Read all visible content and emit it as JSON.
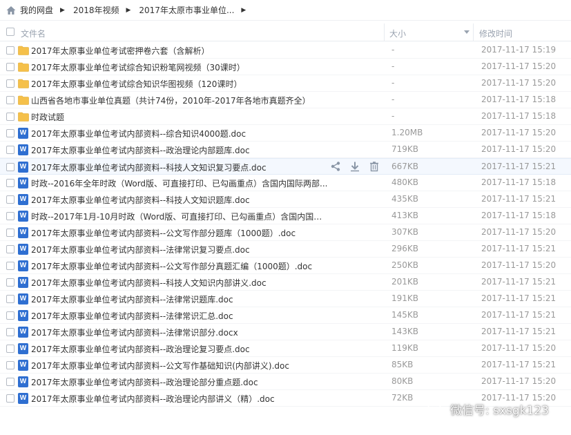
{
  "breadcrumb": {
    "items": [
      {
        "label": "我的网盘",
        "icon": "home-icon"
      },
      {
        "label": "2018年视频"
      },
      {
        "label": "2017年太原市事业单位..."
      }
    ]
  },
  "header": {
    "name_label": "文件名",
    "size_label": "大小",
    "time_label": "修改时间"
  },
  "rows": [
    {
      "type": "folder",
      "name": "2017年太原事业单位考试密押卷六套（含解析）",
      "size": "-",
      "time": "2017-11-17 15:19"
    },
    {
      "type": "folder",
      "name": "2017年太原事业单位考试综合知识粉笔网视频（30课时）",
      "size": "-",
      "time": "2017-11-17 15:20"
    },
    {
      "type": "folder",
      "name": "2017年太原事业单位考试综合知识华图视频（120课时）",
      "size": "-",
      "time": "2017-11-17 15:20"
    },
    {
      "type": "folder",
      "name": "山西省各地市事业单位真题（共计74份，2010年-2017年各地市真题齐全）",
      "size": "-",
      "time": "2017-11-17 15:18"
    },
    {
      "type": "folder",
      "name": "时政试题",
      "size": "-",
      "time": "2017-11-17 15:18"
    },
    {
      "type": "doc",
      "name": "2017年太原事业单位考试内部资料--综合知识4000题.doc",
      "size": "1.20MB",
      "time": "2017-11-17 15:20"
    },
    {
      "type": "doc",
      "name": "2017年太原事业单位考试内部资料--政治理论内部题库.doc",
      "size": "719KB",
      "time": "2017-11-17 15:20"
    },
    {
      "type": "doc",
      "name": "2017年太原事业单位考试内部资料--科技人文知识复习要点.doc",
      "size": "667KB",
      "time": "2017-11-17 15:21",
      "hover": true
    },
    {
      "type": "doc",
      "name": "时政--2016年全年时政（Word版、可直接打印、已勾画重点）含国内国际两部...",
      "size": "480KB",
      "time": "2017-11-17 15:18"
    },
    {
      "type": "doc",
      "name": "2017年太原事业单位考试内部资料--科技人文知识题库.doc",
      "size": "435KB",
      "time": "2017-11-17 15:21"
    },
    {
      "type": "doc",
      "name": "时政--2017年1月-10月时政（Word版、可直接打印、已勾画重点）含国内国际...",
      "size": "413KB",
      "time": "2017-11-17 15:18"
    },
    {
      "type": "doc",
      "name": "2017年太原事业单位考试内部资料--公文写作部分题库（1000题）.doc",
      "size": "307KB",
      "time": "2017-11-17 15:20"
    },
    {
      "type": "doc",
      "name": "2017年太原事业单位考试内部资料--法律常识复习要点.doc",
      "size": "296KB",
      "time": "2017-11-17 15:21"
    },
    {
      "type": "doc",
      "name": "2017年太原事业单位考试内部资料--公文写作部分真题汇编（1000题）.doc",
      "size": "250KB",
      "time": "2017-11-17 15:20"
    },
    {
      "type": "doc",
      "name": "2017年太原事业单位考试内部资料--科技人文知识内部讲义.doc",
      "size": "201KB",
      "time": "2017-11-17 15:21"
    },
    {
      "type": "doc",
      "name": "2017年太原事业单位考试内部资料--法律常识题库.doc",
      "size": "191KB",
      "time": "2017-11-17 15:21"
    },
    {
      "type": "doc",
      "name": "2017年太原事业单位考试内部资料--法律常识汇总.doc",
      "size": "145KB",
      "time": "2017-11-17 15:21"
    },
    {
      "type": "doc",
      "name": "2017年太原事业单位考试内部资料--法律常识部分.docx",
      "size": "143KB",
      "time": "2017-11-17 15:21"
    },
    {
      "type": "doc",
      "name": "2017年太原事业单位考试内部资料--政治理论复习要点.doc",
      "size": "119KB",
      "time": "2017-11-17 15:20"
    },
    {
      "type": "doc",
      "name": "2017年太原事业单位考试内部资料--公文写作基础知识(内部讲义).doc",
      "size": "85KB",
      "time": "2017-11-17 15:21"
    },
    {
      "type": "doc",
      "name": "2017年太原事业单位考试内部资料--政治理论部分重点题.doc",
      "size": "80KB",
      "time": "2017-11-17 15:20"
    },
    {
      "type": "doc",
      "name": "2017年太原事业单位考试内部资料--政治理论内部讲义（精）.doc",
      "size": "72KB",
      "time": "2017-11-17 15:20"
    }
  ],
  "doc_icon_letter": "W",
  "hover_actions": [
    "share-icon",
    "download-icon",
    "delete-icon"
  ],
  "watermark": {
    "text": "微信号: sxsgk123"
  },
  "colors": {
    "folder": "#f5c04a",
    "doc_icon": "#2f6fd1",
    "muted_text": "#999999",
    "hover_row": "#f4f8fe"
  }
}
